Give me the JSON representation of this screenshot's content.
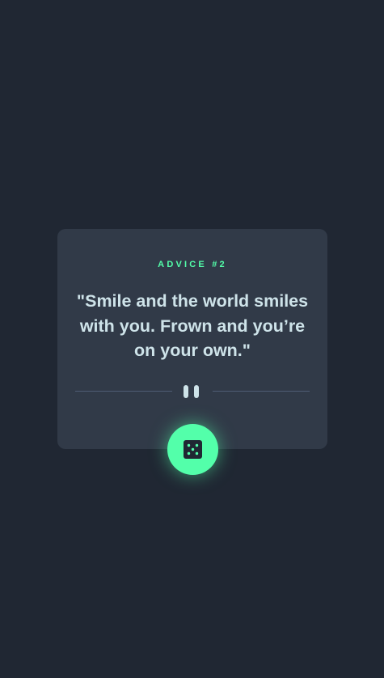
{
  "card": {
    "advice_id": "ADVICE #2",
    "quote": "\"Smile and the world smiles with you. Frown and you’re on your own.\""
  },
  "button": {
    "icon": "dice-icon",
    "color": "#53ffaa"
  },
  "colors": {
    "background": "#202733",
    "card": "#313a48",
    "accent": "#53ffaa",
    "text": "#cee3e9",
    "divider": "#4f5d74"
  }
}
